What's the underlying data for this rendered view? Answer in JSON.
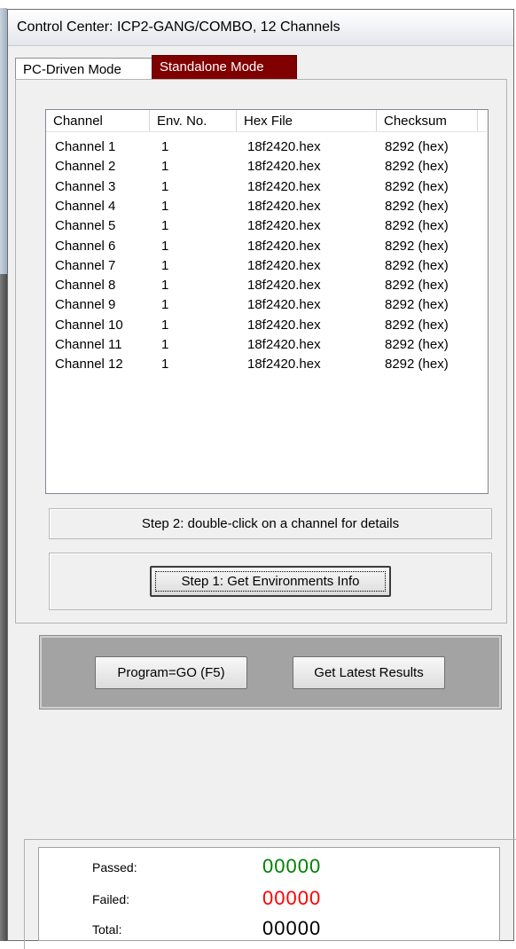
{
  "window": {
    "title": "Control Center: ICP2-GANG/COMBO, 12 Channels"
  },
  "tabs": [
    {
      "label": "PC-Driven Mode",
      "active": false
    },
    {
      "label": "Standalone Mode",
      "active": true
    }
  ],
  "channel_list": {
    "columns": [
      "Channel",
      "Env. No.",
      "Hex File",
      "Checksum"
    ],
    "rows": [
      {
        "channel": "Channel 1",
        "env": "1",
        "hex": "18f2420.hex",
        "checksum": "8292 (hex)"
      },
      {
        "channel": "Channel 2",
        "env": "1",
        "hex": "18f2420.hex",
        "checksum": "8292 (hex)"
      },
      {
        "channel": "Channel 3",
        "env": "1",
        "hex": "18f2420.hex",
        "checksum": "8292 (hex)"
      },
      {
        "channel": "Channel 4",
        "env": "1",
        "hex": "18f2420.hex",
        "checksum": "8292 (hex)"
      },
      {
        "channel": "Channel 5",
        "env": "1",
        "hex": "18f2420.hex",
        "checksum": "8292 (hex)"
      },
      {
        "channel": "Channel 6",
        "env": "1",
        "hex": "18f2420.hex",
        "checksum": "8292 (hex)"
      },
      {
        "channel": "Channel 7",
        "env": "1",
        "hex": "18f2420.hex",
        "checksum": "8292 (hex)"
      },
      {
        "channel": "Channel 8",
        "env": "1",
        "hex": "18f2420.hex",
        "checksum": "8292 (hex)"
      },
      {
        "channel": "Channel 9",
        "env": "1",
        "hex": "18f2420.hex",
        "checksum": "8292 (hex)"
      },
      {
        "channel": "Channel 10",
        "env": "1",
        "hex": "18f2420.hex",
        "checksum": "8292 (hex)"
      },
      {
        "channel": "Channel 11",
        "env": "1",
        "hex": "18f2420.hex",
        "checksum": "8292 (hex)"
      },
      {
        "channel": "Channel 12",
        "env": "1",
        "hex": "18f2420.hex",
        "checksum": "8292 (hex)"
      }
    ]
  },
  "step2_hint": "Step 2: double-click on a channel for details",
  "buttons": {
    "step1": "Step 1: Get Environments Info",
    "program": "Program=GO (F5)",
    "latest": "Get Latest Results"
  },
  "stats": [
    {
      "label": "Passed:",
      "value": "00000",
      "color": "#008000"
    },
    {
      "label": "Failed:",
      "value": "00000",
      "color": "#ff0000"
    },
    {
      "label": "Total:",
      "value": "00000",
      "color": "#000000"
    }
  ],
  "colors": {
    "tab_active": "#800000",
    "action_panel": "#a3a3a3"
  }
}
